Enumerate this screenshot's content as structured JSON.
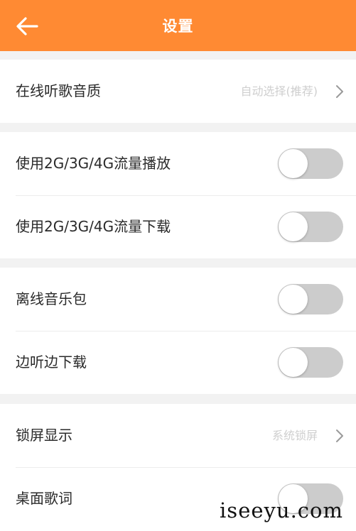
{
  "header": {
    "title": "设置",
    "back_icon": "arrow-left-icon",
    "background_color": "#ff8a33"
  },
  "settings": {
    "online_quality": {
      "label": "在线听歌音质",
      "value": "自动选择(推荐)"
    },
    "mobile_play": {
      "label": "使用2G/3G/4G流量播放",
      "enabled": false
    },
    "mobile_download": {
      "label": "使用2G/3G/4G流量下载",
      "enabled": false
    },
    "offline_pack": {
      "label": "离线音乐包",
      "enabled": false
    },
    "download_while_listening": {
      "label": "边听边下载",
      "enabled": false
    },
    "lock_screen": {
      "label": "锁屏显示",
      "value": "系统锁屏"
    },
    "desktop_lyrics": {
      "label": "桌面歌词",
      "enabled": false
    }
  },
  "watermark": "iseeyu.com",
  "colors": {
    "accent": "#ff8a33",
    "toggle_off": "#cccccc",
    "secondary_text": "#cfcfcf"
  }
}
